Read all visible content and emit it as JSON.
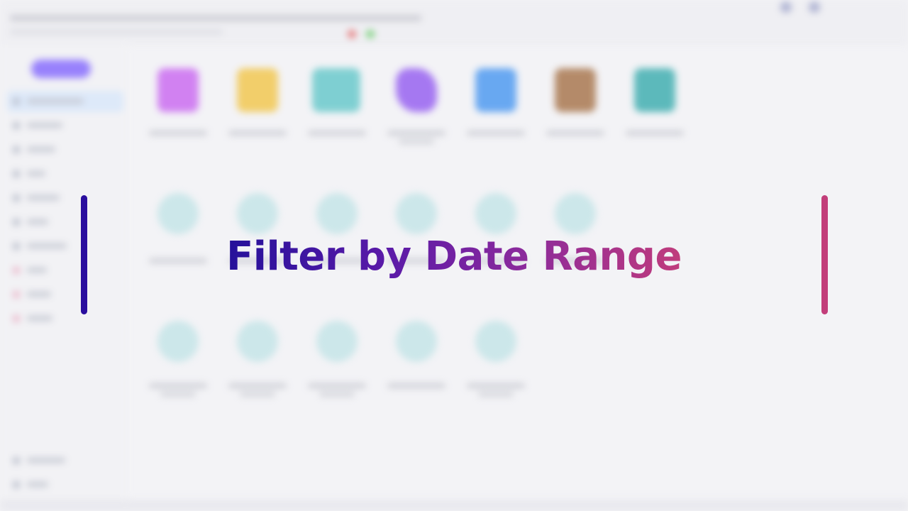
{
  "overlay": {
    "title": "Filter by Date Range",
    "colors": {
      "left_bar": "#2a0e9e",
      "right_bar": "#c23d7a",
      "gradient_start": "#25119a",
      "gradient_end": "#c03c7c"
    }
  },
  "background_app": {
    "state": "blurred",
    "sidebar_item_count": 10,
    "icon_grid_rows": 3,
    "icons": [
      {
        "name": "purple-file-icon",
        "color": "#c65cf0"
      },
      {
        "name": "yellow-folder-icon",
        "color": "#f2c23c"
      },
      {
        "name": "teal-folder-icon",
        "color": "#58c4c6"
      },
      {
        "name": "purple-gem-icon",
        "color": "#8c4ff0"
      },
      {
        "name": "blue-tiles-icon",
        "color": "#3a8ff0"
      },
      {
        "name": "brown-image-icon",
        "color": "#a0683a"
      },
      {
        "name": "teal-book-icon",
        "color": "#2aa6a8"
      }
    ]
  }
}
